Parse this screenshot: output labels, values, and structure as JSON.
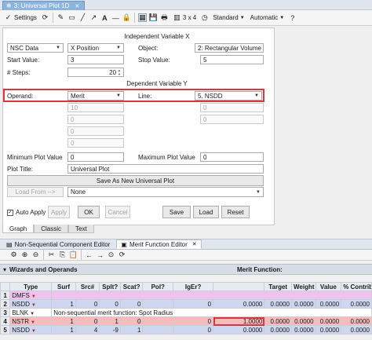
{
  "window": {
    "tab_title": "3: Universal Plot 1D",
    "tab_close": "✕"
  },
  "toolbar": {
    "settings_label": "Settings",
    "layout_label": "3 x 4",
    "standard_label": "Standard",
    "automatic_label": "Automatic"
  },
  "independent": {
    "header": "Independent Variable X",
    "data_type": "NSC Data",
    "variable": "X Position",
    "object_label": "Object:",
    "object_value": "2: Rectangular Volume",
    "start_label": "Start Value:",
    "start_value": "3",
    "stop_label": "Stop Value:",
    "stop_value": "5",
    "steps_label": "# Steps:",
    "steps_value": "20"
  },
  "dependent": {
    "header": "Dependent Variable Y",
    "operand_label": "Operand:",
    "operand_value": "Merit",
    "line_label": "Line:",
    "line_value": "5. NSDD",
    "param_values": [
      "10",
      "0",
      "0",
      "0",
      "0",
      "0"
    ],
    "min_label": "Minimum Plot Value",
    "min_value": "0",
    "max_label": "Maximum Plot Value",
    "max_value": "0",
    "title_label": "Plot Title:",
    "title_value": "Universal Plot"
  },
  "actions": {
    "save_new": "Save As New Universal Plot",
    "load_from": "Load From -->",
    "load_from_value": "None",
    "auto_apply": "Auto Apply",
    "apply": "Apply",
    "ok": "OK",
    "cancel": "Cancel",
    "save": "Save",
    "load": "Load",
    "reset": "Reset"
  },
  "analysis_tabs": [
    "Graph",
    "Classic",
    "Text"
  ],
  "editor_tabs": [
    "Non-Sequential Component Editor",
    "Merit Function Editor"
  ],
  "wizard_bar": {
    "label": "Wizards and Operands",
    "merit_label": "Merit Function:"
  },
  "mf_table": {
    "headers": [
      "Type",
      "Surf",
      "Src#",
      "Splt?",
      "Scat?",
      "Pol?",
      "IgEr?",
      "",
      "Target",
      "Weight",
      "Value",
      "% Contrib"
    ],
    "rows": [
      {
        "n": "1",
        "type": "DMFS",
        "cls": "r-dmfs",
        "cells": [
          "",
          "",
          "",
          "",
          "",
          "",
          "",
          "",
          "",
          "",
          ""
        ]
      },
      {
        "n": "2",
        "type": "NSDD",
        "cls": "r-nsdd",
        "cells": [
          "1",
          "0",
          "0",
          "0",
          "",
          "0",
          "0.0000",
          "0.0000",
          "0.0000",
          "0.0000",
          "0.0000"
        ]
      },
      {
        "n": "3",
        "type": "BLNK",
        "cls": "r-blnk",
        "comment": "Non-sequential merit function: Spot Radius"
      },
      {
        "n": "4",
        "type": "NSTR",
        "cls": "r-nstr",
        "cells": [
          "1",
          "0",
          "1",
          "0",
          "",
          "0",
          "1.0000",
          "0.0000",
          "0.0000",
          "0.0000",
          "0.0000"
        ]
      },
      {
        "n": "5",
        "type": "NSDD",
        "cls": "r-nsdd",
        "cells": [
          "1",
          "4",
          "-9",
          "1",
          "",
          "0",
          "0.0000",
          "0.0000",
          "0.0000",
          "0.0000",
          "0.0000"
        ]
      }
    ]
  }
}
